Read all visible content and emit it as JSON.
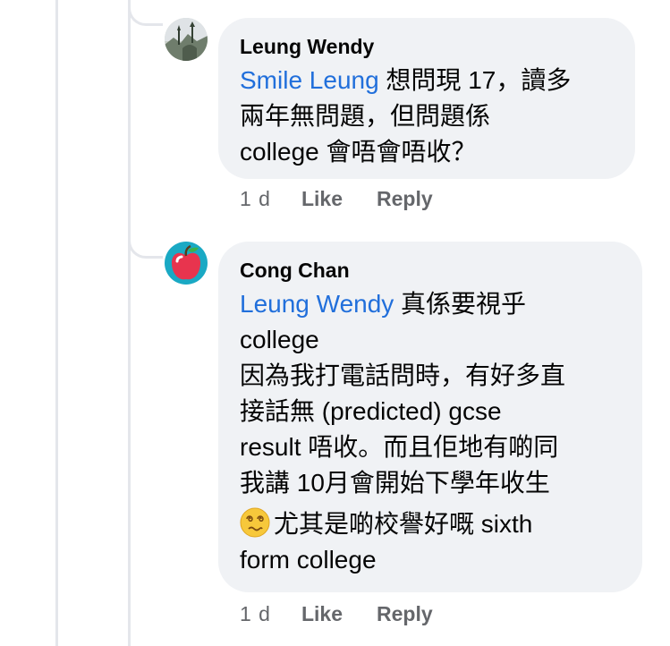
{
  "comments": [
    {
      "author": "Leung Wendy",
      "mention": "Smile Leung",
      "text_lines": [
        " 想問現 17，讀多",
        "兩年無問題，但問題係",
        "college 會唔會唔收？"
      ],
      "time": "1 d",
      "like_label": "Like",
      "reply_label": "Reply",
      "avatar_icon": "landscape-photo-avatar"
    },
    {
      "author": "Cong Chan",
      "mention": "Leung Wendy",
      "text_lines": [
        " 真係要視乎",
        "college",
        "因為我打電話問時，有好多直",
        "接話無 (predicted) gcse",
        "result 唔收。而且佢地有啲同",
        "我講 10月會開始下學年收生"
      ],
      "emoji_icon": "dizzy-face-emoji",
      "emoji_line_1": "尤其是啲校譽好嘅 sixth",
      "emoji_line_2": "form college",
      "time": "1 d",
      "like_label": "Like",
      "reply_label": "Reply",
      "avatar_icon": "apple-avatar"
    }
  ],
  "colors": {
    "bubble_bg": "#f0f2f5",
    "mention": "#216fdb",
    "meta_text": "#65676b",
    "thread_line": "#e4e6eb"
  }
}
